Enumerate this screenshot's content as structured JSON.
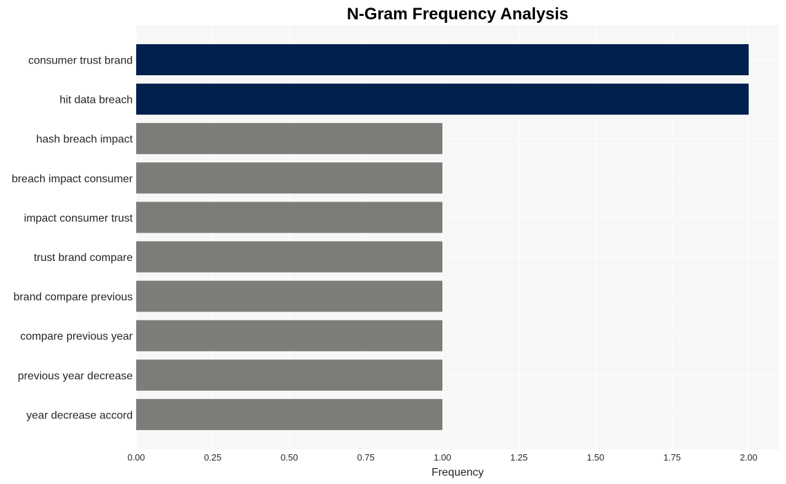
{
  "chart_data": {
    "type": "bar",
    "orientation": "horizontal",
    "title": "N-Gram Frequency Analysis",
    "xlabel": "Frequency",
    "ylabel": "",
    "categories": [
      "consumer trust brand",
      "hit data breach",
      "hash breach impact",
      "breach impact consumer",
      "impact consumer trust",
      "trust brand compare",
      "brand compare previous",
      "compare previous year",
      "previous year decrease",
      "year decrease accord"
    ],
    "values": [
      2,
      2,
      1,
      1,
      1,
      1,
      1,
      1,
      1,
      1
    ],
    "bar_colors": [
      "#00214e",
      "#00214e",
      "#7d7c78",
      "#7d7c78",
      "#7d7c78",
      "#7d7c78",
      "#7d7c78",
      "#7d7c78",
      "#7d7c78",
      "#7d7c78"
    ],
    "xlim": [
      0,
      2.1
    ],
    "xticks": [
      0,
      0.25,
      0.5,
      0.75,
      1.0,
      1.25,
      1.5,
      1.75,
      2.0
    ],
    "xtick_labels": [
      "0.00",
      "0.25",
      "0.50",
      "0.75",
      "1.00",
      "1.25",
      "1.50",
      "1.75",
      "2.00"
    ],
    "grid": true,
    "background": "#f7f7f7",
    "legend": "none"
  }
}
